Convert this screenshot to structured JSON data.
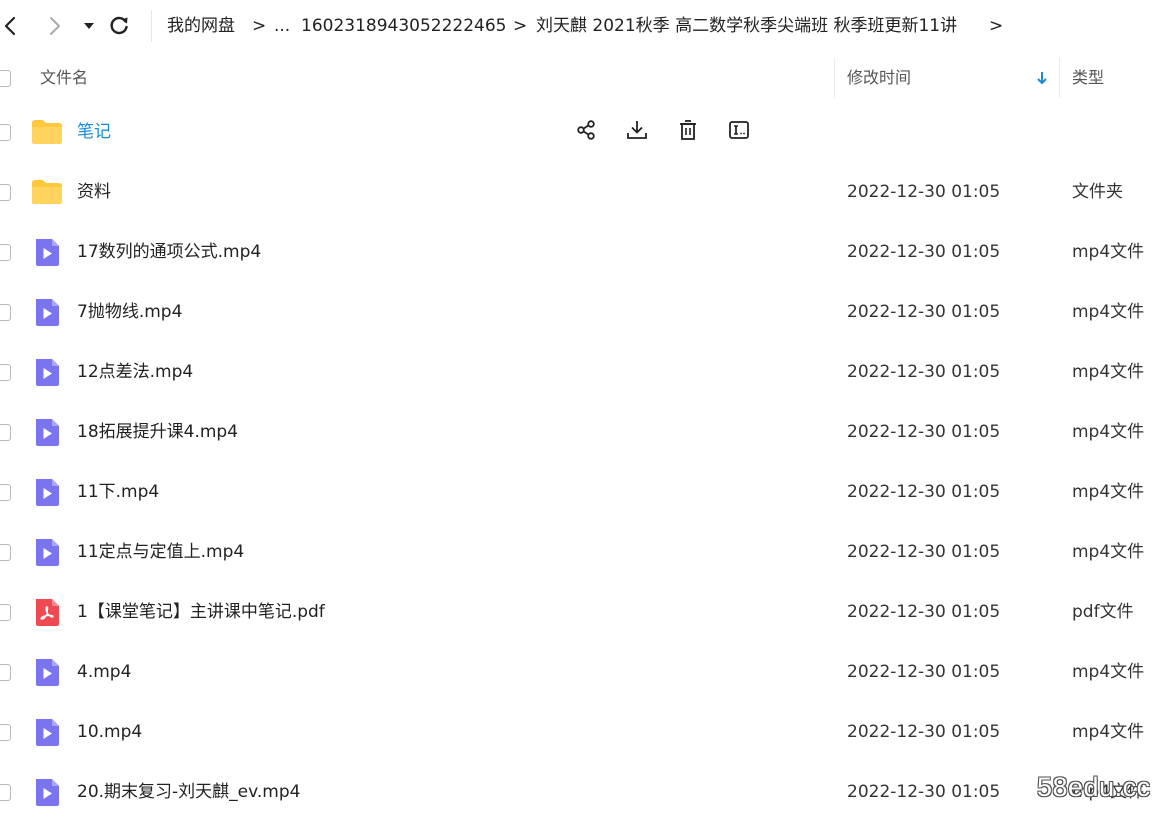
{
  "toolbar": {
    "back_icon": "chevron-left-icon",
    "forward_icon": "chevron-right-icon",
    "history_icon": "caret-down-icon",
    "refresh_icon": "refresh-icon"
  },
  "breadcrumb": {
    "items": [
      "我的网盘",
      "...",
      "1602318943052222465",
      "刘天麒 2021秋季 高二数学秋季尖端班 秋季班更新11讲"
    ],
    "separator": ">"
  },
  "columns": {
    "name": "文件名",
    "modified": "修改时间",
    "type": "类型",
    "sort_icon": "arrow-down-icon"
  },
  "colors": {
    "accent": "#1a8ad6",
    "folder": "#ffc83d",
    "video": "#7b74f0",
    "pdf": "#ef4a52"
  },
  "files": [
    {
      "name": "笔记",
      "time": "",
      "type": "",
      "icon": "folder-icon",
      "hovered": true
    },
    {
      "name": "资料",
      "time": "2022-12-30 01:05",
      "type": "文件夹",
      "icon": "folder-icon"
    },
    {
      "name": "17数列的通项公式.mp4",
      "time": "2022-12-30 01:05",
      "type": "mp4文件",
      "icon": "video-file-icon"
    },
    {
      "name": "7抛物线.mp4",
      "time": "2022-12-30 01:05",
      "type": "mp4文件",
      "icon": "video-file-icon"
    },
    {
      "name": "12点差法.mp4",
      "time": "2022-12-30 01:05",
      "type": "mp4文件",
      "icon": "video-file-icon"
    },
    {
      "name": "18拓展提升课4.mp4",
      "time": "2022-12-30 01:05",
      "type": "mp4文件",
      "icon": "video-file-icon"
    },
    {
      "name": "11下.mp4",
      "time": "2022-12-30 01:05",
      "type": "mp4文件",
      "icon": "video-file-icon"
    },
    {
      "name": "11定点与定值上.mp4",
      "time": "2022-12-30 01:05",
      "type": "mp4文件",
      "icon": "video-file-icon"
    },
    {
      "name": "1【课堂笔记】主讲课中笔记.pdf",
      "time": "2022-12-30 01:05",
      "type": "pdf文件",
      "icon": "pdf-file-icon"
    },
    {
      "name": "4.mp4",
      "time": "2022-12-30 01:05",
      "type": "mp4文件",
      "icon": "video-file-icon"
    },
    {
      "name": "10.mp4",
      "time": "2022-12-30 01:05",
      "type": "mp4文件",
      "icon": "video-file-icon"
    },
    {
      "name": "20.期末复习-刘天麒_ev.mp4",
      "time": "2022-12-30 01:05",
      "type": "mp4文件",
      "icon": "video-file-icon"
    }
  ],
  "row_actions": [
    "share-icon",
    "download-icon",
    "delete-icon",
    "rename-icon"
  ],
  "watermark": "58edu.cc"
}
